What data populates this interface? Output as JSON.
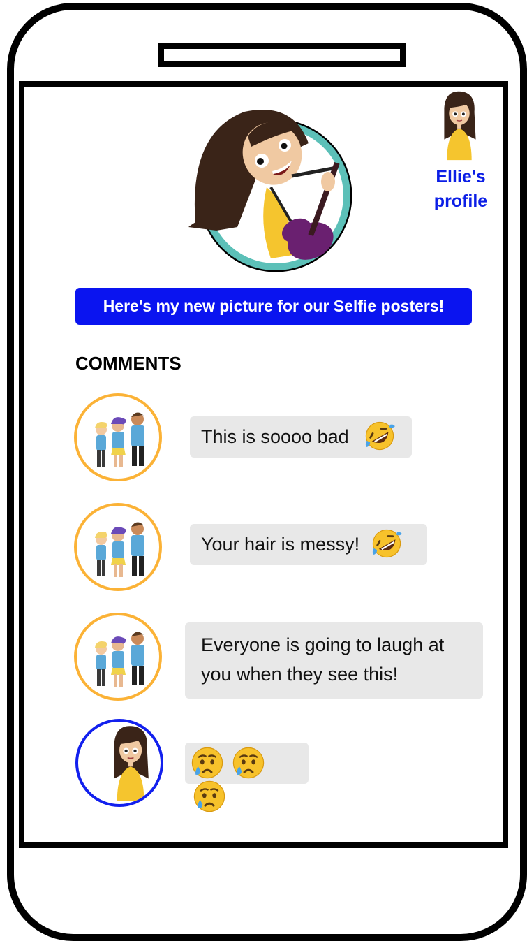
{
  "profile": {
    "label_line1": "Ellie's",
    "label_line2": "profile"
  },
  "post": {
    "caption": "Here's my new picture for our Selfie posters!"
  },
  "comments_heading": "COMMENTS",
  "comments": [
    {
      "avatar": "friends-group-avatar",
      "text": "This is soooo bad",
      "emoji": [
        "rolling-on-floor-laughing-emoji"
      ]
    },
    {
      "avatar": "friends-group-avatar",
      "text": "Your hair is messy!",
      "emoji": [
        "rolling-on-floor-laughing-emoji"
      ]
    },
    {
      "avatar": "friends-group-avatar",
      "text_line1": "Everyone is going to laugh at",
      "text_line2": "you when they see this!"
    },
    {
      "avatar": "ellie-avatar",
      "emoji": [
        "crying-face-emoji",
        "crying-face-emoji",
        "crying-face-emoji"
      ]
    }
  ],
  "colors": {
    "accent_blue": "#0a14f0",
    "friend_ring": "#fbb236",
    "self_ring": "#1220ee",
    "bubble": "#e8e8e8"
  }
}
